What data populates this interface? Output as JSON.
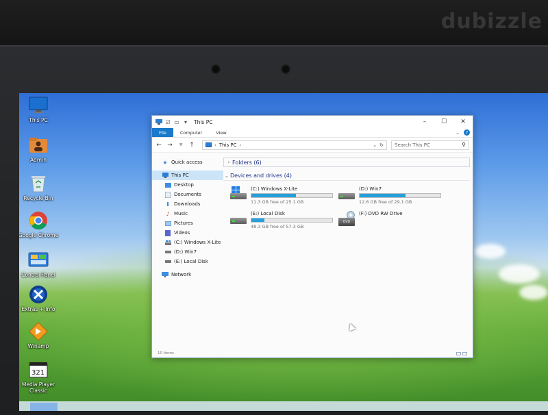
{
  "photo": {
    "watermark": "dubizzle"
  },
  "desktop": {
    "icons": [
      {
        "label": "This PC",
        "icon": "monitor-icon"
      },
      {
        "label": "Admin",
        "icon": "user-folder-icon"
      },
      {
        "label": "Recycle Bin",
        "icon": "recycle-bin-icon"
      },
      {
        "label": "Google Chrome",
        "icon": "chrome-icon"
      },
      {
        "label": "Control Panel",
        "icon": "control-panel-icon"
      },
      {
        "label": "Extras + Info",
        "icon": "extras-icon"
      },
      {
        "label": "Winamp",
        "icon": "winamp-icon"
      },
      {
        "label": "Media Player Classic",
        "icon": "media-player-icon"
      }
    ]
  },
  "window": {
    "title": "This PC",
    "ribbon": {
      "file": "File",
      "computer": "Computer",
      "view": "View"
    },
    "address": {
      "path": "This PC"
    },
    "search": {
      "placeholder": "Search This PC"
    },
    "nav": {
      "quick_access": "Quick access",
      "this_pc": "This PC",
      "items": [
        "Desktop",
        "Documents",
        "Downloads",
        "Music",
        "Pictures",
        "Videos",
        "(C:) Windows X-Lite",
        "(D:) Win7",
        "(E:) Local Disk"
      ],
      "network": "Network"
    },
    "folders_header": "Folders (6)",
    "devices_header": "Devices and drives (4)",
    "drives": [
      {
        "name": "(C:) Windows X-Lite",
        "free": "11.3 GB free of 25.1 GB",
        "used_fraction": 0.55,
        "icon": "windows-drive-icon"
      },
      {
        "name": "(D:) Win7",
        "free": "12.6 GB free of 29.1 GB",
        "used_fraction": 0.57,
        "icon": "hard-drive-icon"
      },
      {
        "name": "(E:) Local Disk",
        "free": "48.3 GB free of 57.3 GB",
        "used_fraction": 0.16,
        "icon": "hard-drive-icon"
      },
      {
        "name": "(F:) DVD RW Drive",
        "free": "",
        "icon": "dvd-drive-icon"
      }
    ],
    "dvd_label": "DVD",
    "status": {
      "items": "10 items"
    }
  },
  "colors": {
    "accent": "#1979ca",
    "bar_fill": "#26a0da",
    "selection": "#cce4f7"
  }
}
